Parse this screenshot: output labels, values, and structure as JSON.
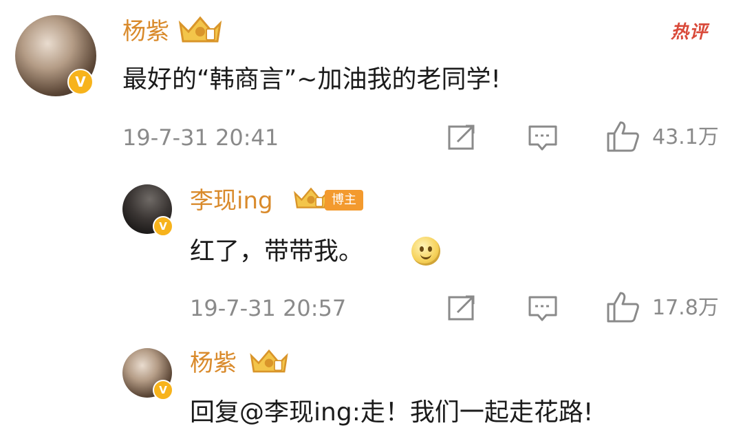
{
  "hot_badge": "热评",
  "comments": [
    {
      "username": "杨紫",
      "content": "最好的“韩商言”~加油我的老同学!",
      "timestamp": "19-7-31 20:41",
      "likes": "43.1万"
    },
    {
      "username": "李现ing",
      "tag": "博主",
      "content": "红了，带带我。",
      "timestamp": "19-7-31 20:57",
      "likes": "17.8万"
    },
    {
      "username": "杨紫",
      "content_prefix": "回复",
      "mention": "@李现ing",
      "content_suffix": ":走！我们一起走花路!"
    }
  ],
  "icons": {
    "verified": "verified-v-badge",
    "crown": "crown-membership-icon",
    "forward": "forward-icon",
    "comment": "comment-icon",
    "like": "thumbs-up-icon",
    "emoji": "smile-emoji"
  },
  "colors": {
    "username": "#d98a2b",
    "tag_background": "#f39a2e",
    "hot_badge": "#d94a3a",
    "meta_text": "#8a8a8a",
    "verified_badge": "#f7b31c"
  }
}
